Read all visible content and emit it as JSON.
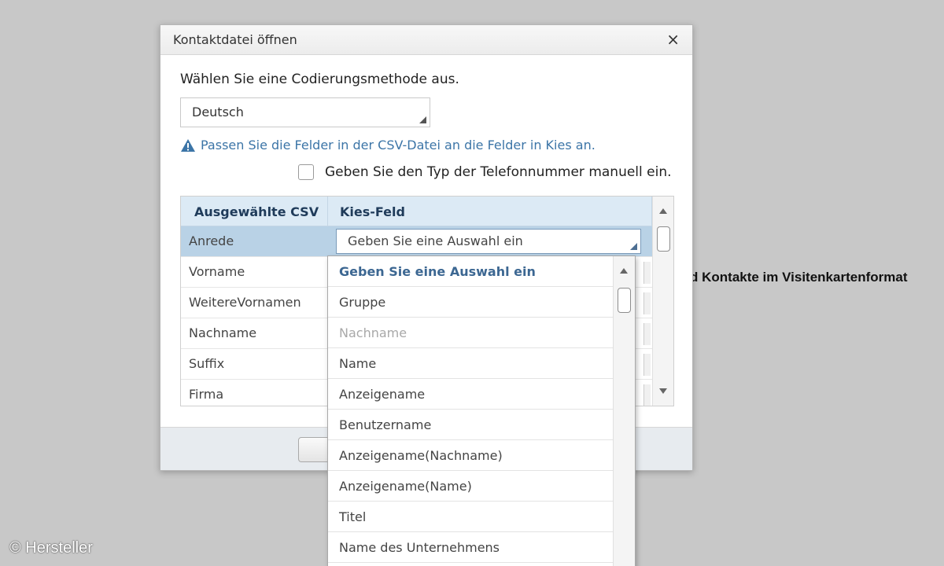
{
  "background": {
    "partial_text": "d Kontakte im Visitenkartenformat",
    "watermark": "© Hersteller"
  },
  "dialog": {
    "title": "Kontaktdatei öffnen",
    "close_label": "×",
    "encoding_label": "Wählen Sie eine Codierungsmethode aus.",
    "encoding_value": "Deutsch",
    "hint_text": "Passen Sie die Felder in der CSV-Datei an die Felder in Kies an.",
    "checkbox_label": "Geben Sie den Typ der Telefonnummer manuell ein.",
    "checkbox_checked": false,
    "grid": {
      "col1_header": "Ausgewählte CSV",
      "col2_header": "Kies-Feld",
      "rows": [
        {
          "label": "Anrede",
          "value": "Geben Sie eine Auswahl ein",
          "selected": true
        },
        {
          "label": "Vorname",
          "value": ""
        },
        {
          "label": "WeitereVornamen",
          "value": ""
        },
        {
          "label": "Nachname",
          "value": ""
        },
        {
          "label": "Suffix",
          "value": ""
        },
        {
          "label": "Firma",
          "value": ""
        }
      ]
    },
    "dropdown": {
      "items": [
        {
          "label": "Geben Sie eine Auswahl ein",
          "style": "head"
        },
        {
          "label": "Gruppe",
          "style": ""
        },
        {
          "label": "Nachname",
          "style": "disabled"
        },
        {
          "label": "Name",
          "style": ""
        },
        {
          "label": "Anzeigename",
          "style": ""
        },
        {
          "label": "Benutzername",
          "style": ""
        },
        {
          "label": "Anzeigename(Nachname)",
          "style": ""
        },
        {
          "label": "Anzeigename(Name)",
          "style": ""
        },
        {
          "label": "Titel",
          "style": ""
        },
        {
          "label": "Name des Unternehmens",
          "style": ""
        }
      ]
    }
  },
  "colors": {
    "accent_link": "#3c75a7",
    "header_bg": "#dceaf5",
    "selected_row": "#b9d2e6"
  },
  "icons": [
    "close-icon",
    "warning-icon",
    "dropdown-corner-icon",
    "scroll-up-icon",
    "scroll-down-icon"
  ]
}
